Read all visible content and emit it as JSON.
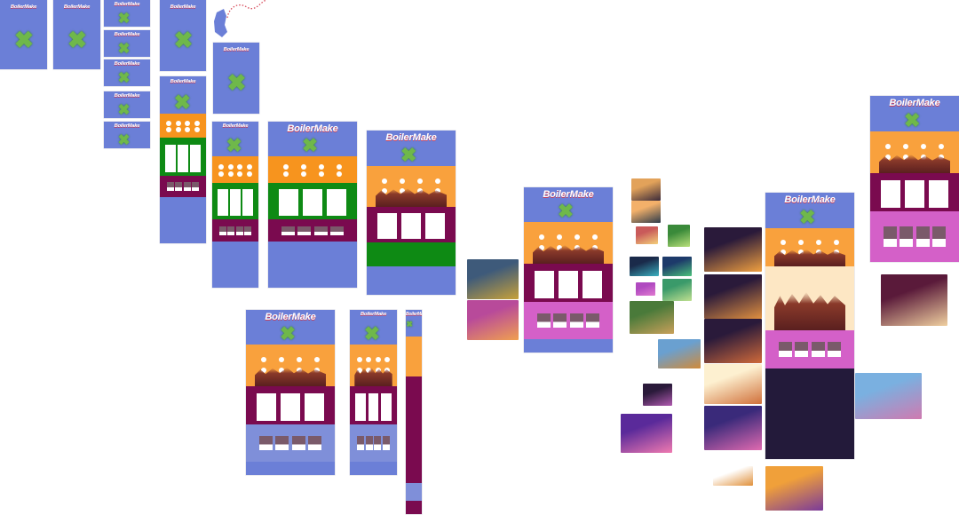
{
  "canvas": {
    "title": "BoilerMake design canvas"
  },
  "brand": {
    "logo_text": "BoilerMake"
  },
  "colors": {
    "hero_blue": "#6b7fd7",
    "orange": "#f7941e",
    "light_orange": "#f9a13d",
    "green": "#0e8a14",
    "purple": "#7a0a4f",
    "magenta": "#d460c8",
    "lavender": "#7f8fd9",
    "cream": "#fde7c4",
    "night": "#231a3a",
    "dotted_path": "#d64a5a"
  }
}
